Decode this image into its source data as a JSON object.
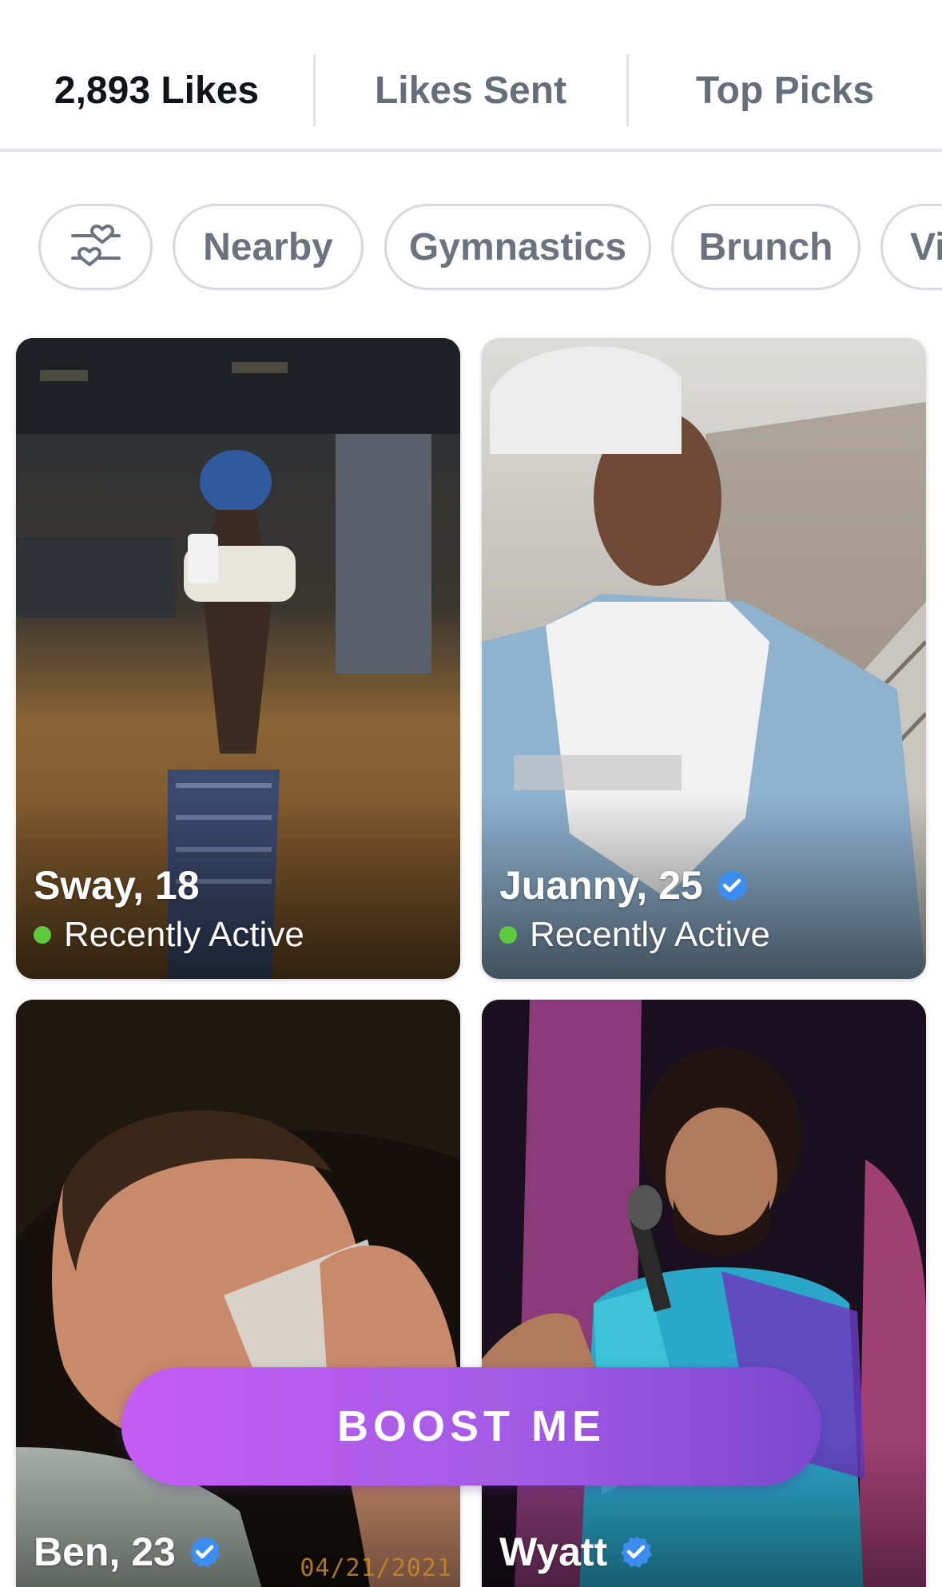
{
  "tabs": [
    {
      "label": "2,893 Likes",
      "active": true
    },
    {
      "label": "Likes Sent",
      "active": false
    },
    {
      "label": "Top Picks",
      "active": false
    }
  ],
  "filters": {
    "settings_icon": "heart-sliders-icon",
    "chips": [
      "Nearby",
      "Gymnastics",
      "Brunch",
      "Vi"
    ]
  },
  "cards": [
    {
      "name": "Sway, 18",
      "status": "Recently Active",
      "verified": false
    },
    {
      "name": "Juanny, 25",
      "status": "Recently Active",
      "verified": true
    },
    {
      "name": "Ben, 23",
      "verified": true,
      "stamp": "04/21/2021"
    },
    {
      "name": "Wyatt",
      "verified": true
    }
  ],
  "boost_button": {
    "label": "BOOST ME"
  },
  "colors": {
    "active_tab_text": "#111418",
    "inactive_tab_text": "#656e7b",
    "online_dot": "#5ecb3f",
    "verified_badge": "#3b8ef0",
    "boost_gradient_start": "#c65cf4",
    "boost_gradient_end": "#7b47cf"
  }
}
